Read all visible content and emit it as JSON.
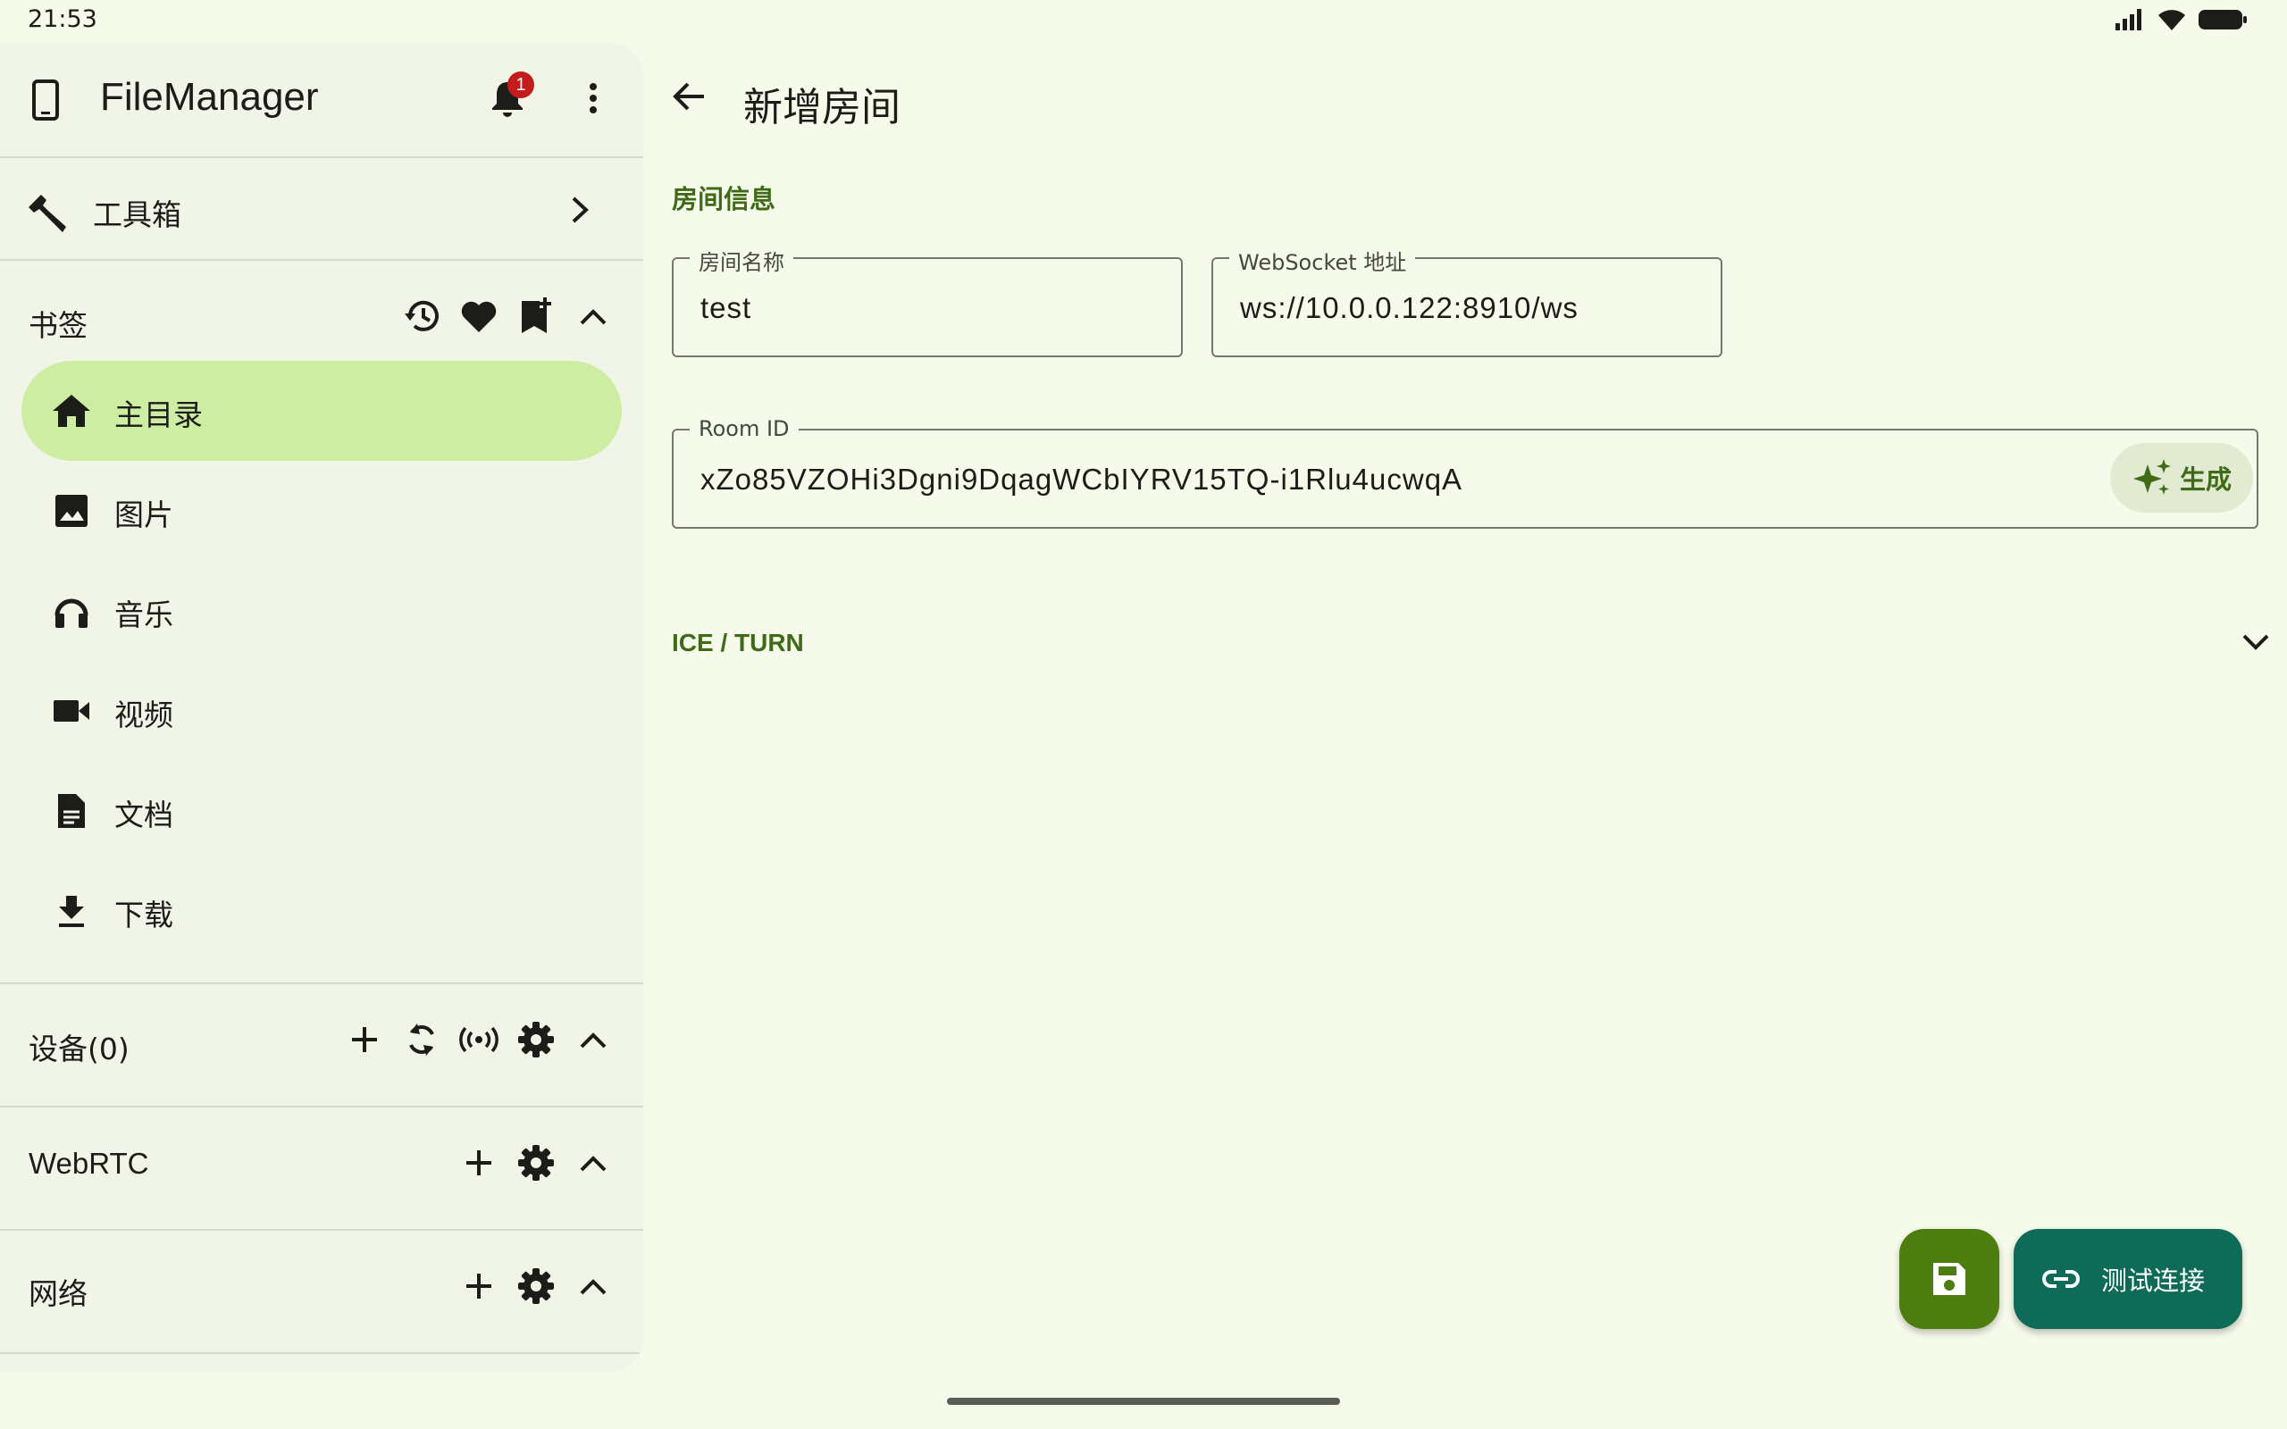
{
  "status_bar": {
    "time": "21:53"
  },
  "drawer": {
    "app_title": "FileManager",
    "notification_count": "1",
    "toolbox_label": "工具箱",
    "bookmarks": {
      "title": "书签",
      "items": [
        {
          "label": "主目录",
          "icon": "home-icon",
          "active": true
        },
        {
          "label": "图片",
          "icon": "image-icon"
        },
        {
          "label": "音乐",
          "icon": "headphones-icon"
        },
        {
          "label": "视频",
          "icon": "videocam-icon"
        },
        {
          "label": "文档",
          "icon": "document-icon"
        },
        {
          "label": "下载",
          "icon": "download-icon"
        }
      ]
    },
    "devices": {
      "title": "设备(0)"
    },
    "webrtc": {
      "title": "WebRTC"
    },
    "network": {
      "title": "网络"
    }
  },
  "main": {
    "title": "新增房间",
    "section_title": "房间信息",
    "room_name": {
      "label": "房间名称",
      "value": "test"
    },
    "websocket": {
      "label": "WebSocket 地址",
      "value": "ws://10.0.0.122:8910/ws"
    },
    "room_id": {
      "label": "Room ID",
      "value": "xZo85VZOHi3Dgni9DqagWCbIYRV15TQ-i1Rlu4ucwqA",
      "generate_label": "生成"
    },
    "ice_label": "ICE / TURN",
    "test_connection_label": "测试连接"
  },
  "colors": {
    "accent": "#3f6b18",
    "active_nav": "#cdeda2",
    "save_fab": "#4d7c0f",
    "test_fab": "#0d6b57",
    "badge": "#c41b1b"
  }
}
